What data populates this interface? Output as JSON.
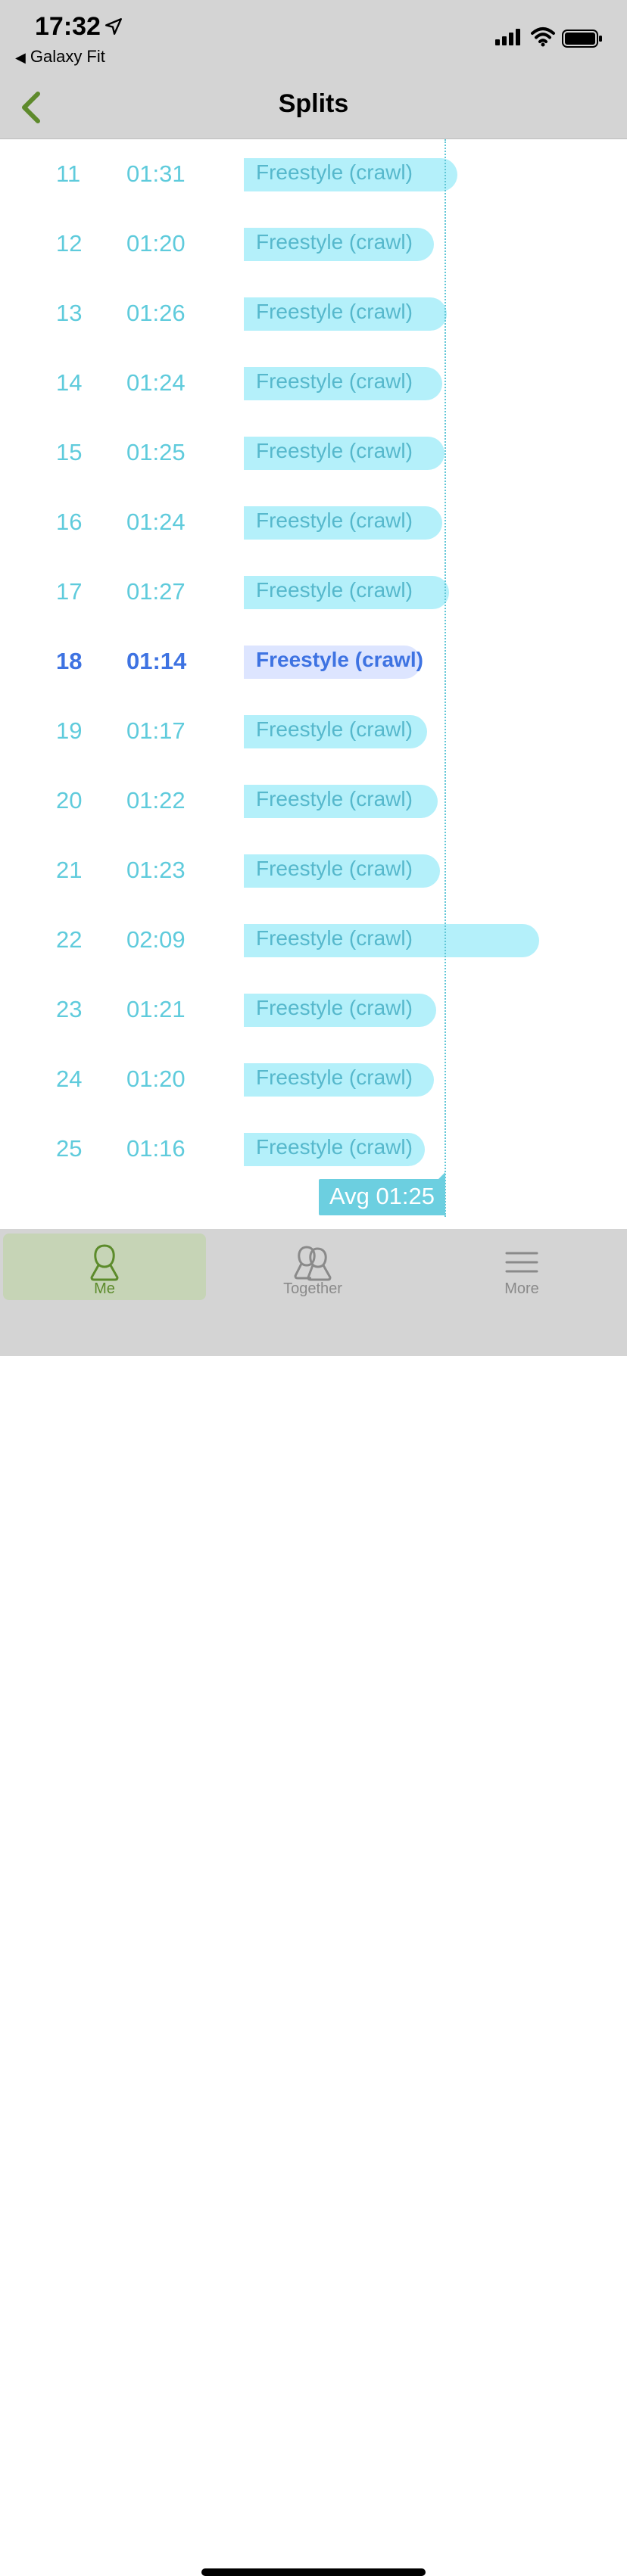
{
  "status_bar": {
    "time": "17:32",
    "back_app": "Galaxy Fit"
  },
  "header": {
    "title": "Splits"
  },
  "splits": [
    {
      "num": "11",
      "time": "01:31",
      "stroke": "Freestyle (crawl)"
    },
    {
      "num": "12",
      "time": "01:20",
      "stroke": "Freestyle (crawl)"
    },
    {
      "num": "13",
      "time": "01:26",
      "stroke": "Freestyle (crawl)"
    },
    {
      "num": "14",
      "time": "01:24",
      "stroke": "Freestyle (crawl)"
    },
    {
      "num": "15",
      "time": "01:25",
      "stroke": "Freestyle (crawl)"
    },
    {
      "num": "16",
      "time": "01:24",
      "stroke": "Freestyle (crawl)"
    },
    {
      "num": "17",
      "time": "01:27",
      "stroke": "Freestyle (crawl)"
    },
    {
      "num": "18",
      "time": "01:14",
      "stroke": "Freestyle (crawl)",
      "highlight": true
    },
    {
      "num": "19",
      "time": "01:17",
      "stroke": "Freestyle (crawl)"
    },
    {
      "num": "20",
      "time": "01:22",
      "stroke": "Freestyle (crawl)"
    },
    {
      "num": "21",
      "time": "01:23",
      "stroke": "Freestyle (crawl)"
    },
    {
      "num": "22",
      "time": "02:09",
      "stroke": "Freestyle (crawl)"
    },
    {
      "num": "23",
      "time": "01:21",
      "stroke": "Freestyle (crawl)"
    },
    {
      "num": "24",
      "time": "01:20",
      "stroke": "Freestyle (crawl)"
    },
    {
      "num": "25",
      "time": "01:16",
      "stroke": "Freestyle (crawl)"
    }
  ],
  "average": {
    "label": "Avg 01:25"
  },
  "tabs": {
    "me": "Me",
    "together": "Together",
    "more": "More"
  },
  "colors": {
    "accent_green": "#5c8b2b",
    "bar": "#b4f0fa",
    "highlight": "#3e73e2"
  },
  "icons": {
    "back": "chevron-left-icon",
    "me": "person-icon",
    "together": "two-people-icon",
    "more": "hamburger-icon"
  }
}
